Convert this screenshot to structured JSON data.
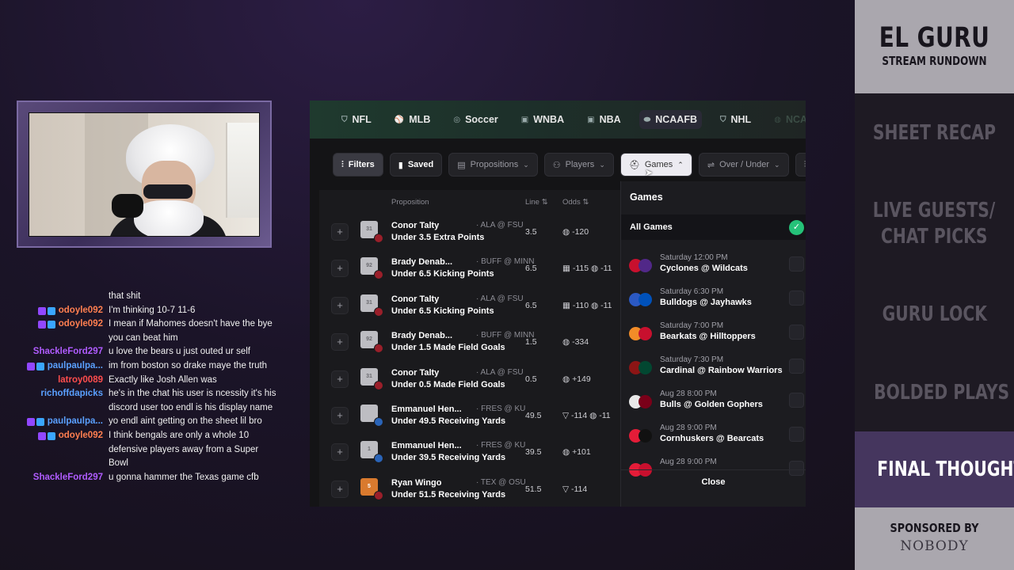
{
  "chat": [
    {
      "name": "",
      "color": "#ffffff",
      "badges": false,
      "message": "that shit"
    },
    {
      "name": "odoyle092",
      "color": "#ff7f50",
      "badges": true,
      "message": "I'm thinking 10-7 11-6"
    },
    {
      "name": "odoyle092",
      "color": "#ff7f50",
      "badges": true,
      "message": "I mean if Mahomes doesn't have the bye you can beat him"
    },
    {
      "name": "ShackleFord297",
      "color": "#b05cff",
      "badges": false,
      "message": "u love the bears u just outed ur self"
    },
    {
      "name": "paulpaulpa...",
      "color": "#5aa0ff",
      "badges": true,
      "message": "im from boston so drake maye the truth"
    },
    {
      "name": "latroy0089",
      "color": "#ff4d4d",
      "badges": false,
      "message": "Exactly like Josh Allen was"
    },
    {
      "name": "richoffdapicks",
      "color": "#5aa0ff",
      "badges": false,
      "message": "he's in the chat his user is ncessity it's his discord user too endl is his display name"
    },
    {
      "name": "paulpaulpa...",
      "color": "#5aa0ff",
      "badges": true,
      "message": "yo endl aint getting on the sheet lil bro"
    },
    {
      "name": "odoyle092",
      "color": "#ff7f50",
      "badges": true,
      "message": "I think bengals are only a whole 10 defensive players away from a Super Bowl"
    },
    {
      "name": "ShackleFord297",
      "color": "#b05cff",
      "badges": false,
      "message": "u gonna hammer the Texas game cfb"
    }
  ],
  "sports": [
    {
      "label": "NFL",
      "icon": "nfl-shield-icon",
      "state": "normal"
    },
    {
      "label": "MLB",
      "icon": "mlb-icon",
      "state": "normal"
    },
    {
      "label": "Soccer",
      "icon": "soccer-ball-icon",
      "state": "normal"
    },
    {
      "label": "WNBA",
      "icon": "wnba-icon",
      "state": "normal"
    },
    {
      "label": "NBA",
      "icon": "nba-icon",
      "state": "normal"
    },
    {
      "label": "NCAAFB",
      "icon": "football-icon",
      "state": "active"
    },
    {
      "label": "NHL",
      "icon": "nhl-icon",
      "state": "normal"
    },
    {
      "label": "NCAAMB",
      "icon": "basketball-icon",
      "state": "faded"
    }
  ],
  "filters": [
    {
      "label": "Filters",
      "icon": "sliders-icon",
      "style": "lite"
    },
    {
      "label": "Saved",
      "icon": "bookmark-icon",
      "style": "bold"
    },
    {
      "label": "Propositions",
      "icon": "list-icon",
      "style": "normal",
      "chevron": "down"
    },
    {
      "label": "Players",
      "icon": "person-icon",
      "style": "normal",
      "chevron": "down"
    },
    {
      "label": "Games",
      "icon": "helmet-icon",
      "style": "open",
      "chevron": "up"
    },
    {
      "label": "Over / Under",
      "icon": "arrows-icon",
      "style": "normal",
      "chevron": "down"
    }
  ],
  "table": {
    "headers": {
      "proposition": "Proposition",
      "line": "Line ⇅",
      "odds": "Odds ⇅"
    },
    "rows": [
      {
        "number": "31",
        "player": "Conor Talty",
        "matchup": "· ALA @ FSU",
        "prop": "Under 3.5 Extra Points",
        "line": "3.5",
        "odds": "◍ -120",
        "logo": "#9a1f2a",
        "jersey": "gray"
      },
      {
        "number": "92",
        "player": "Brady Denab...",
        "matchup": "· BUFF @ MINN",
        "prop": "Under 6.5 Kicking Points",
        "line": "6.5",
        "odds": "▦ -115 ◍ -11",
        "logo": "#9a1f2a",
        "jersey": "gray"
      },
      {
        "number": "31",
        "player": "Conor Talty",
        "matchup": "· ALA @ FSU",
        "prop": "Under 6.5 Kicking Points",
        "line": "6.5",
        "odds": "▦ -110 ◍ -11",
        "logo": "#9a1f2a",
        "jersey": "gray"
      },
      {
        "number": "92",
        "player": "Brady Denab...",
        "matchup": "· BUFF @ MINN",
        "prop": "Under 1.5 Made Field Goals",
        "line": "1.5",
        "odds": "◍ -334",
        "logo": "#9a1f2a",
        "jersey": "gray"
      },
      {
        "number": "31",
        "player": "Conor Talty",
        "matchup": "· ALA @ FSU",
        "prop": "Under 0.5 Made Field Goals",
        "line": "0.5",
        "odds": "◍ +149",
        "logo": "#9a1f2a",
        "jersey": "gray"
      },
      {
        "number": "",
        "player": "Emmanuel Hen...",
        "matchup": "· FRES @ KU",
        "prop": "Under 49.5 Receiving Yards",
        "line": "49.5",
        "odds": "▽ -114 ◍ -11",
        "logo": "#2a64b8",
        "jersey": "gray"
      },
      {
        "number": "1",
        "player": "Emmanuel Hen...",
        "matchup": "· FRES @ KU",
        "prop": "Under 39.5 Receiving Yards",
        "line": "39.5",
        "odds": "◍ +101",
        "logo": "#2a64b8",
        "jersey": "gray"
      },
      {
        "number": "5",
        "player": "Ryan Wingo",
        "matchup": "· TEX @ OSU",
        "prop": "Under 51.5 Receiving Yards",
        "line": "51.5",
        "odds": "▽ -114",
        "logo": "#9a1f2a",
        "jersey": "orange"
      }
    ]
  },
  "games_dropdown": {
    "title": "Games",
    "all_label": "All Games",
    "games": [
      {
        "time": "Saturday 12:00 PM",
        "matchup": "Cyclones @ Wildcats",
        "color_a": "#c8102e",
        "color_b": "#512888"
      },
      {
        "time": "Saturday 6:30 PM",
        "matchup": "Bulldogs @ Jayhawks",
        "color_a": "#2b59c3",
        "color_b": "#0051ba"
      },
      {
        "time": "Saturday 7:00 PM",
        "matchup": "Bearkats @ Hilltoppers",
        "color_a": "#f28c28",
        "color_b": "#c8102e"
      },
      {
        "time": "Saturday 7:30 PM",
        "matchup": "Cardinal @ Rainbow Warriors",
        "color_a": "#8c1515",
        "color_b": "#024731"
      },
      {
        "time": "Aug 28 8:00 PM",
        "matchup": "Bulls @ Golden Gophers",
        "color_a": "#e8e8e8",
        "color_b": "#7a0019"
      },
      {
        "time": "Aug 28 9:00 PM",
        "matchup": "Cornhuskers @ Bearcats",
        "color_a": "#e41c38",
        "color_b": "#111111"
      },
      {
        "time": "Aug 28 9:00 PM",
        "matchup": "",
        "color_a": "#e41c38",
        "color_b": "#c8102e"
      }
    ],
    "close_label": "Close"
  },
  "rundown": {
    "title": "EL GURU",
    "subtitle": "STREAM RUNDOWN",
    "items": [
      "SHEET RECAP",
      "LIVE GUESTS/",
      "CHAT PICKS",
      "GURU LOCK",
      "BOLDED PLAYS"
    ],
    "final": "FINAL THOUGHTS",
    "sponsor_label": "SPONSORED BY",
    "sponsor_name": "NOBODY"
  }
}
